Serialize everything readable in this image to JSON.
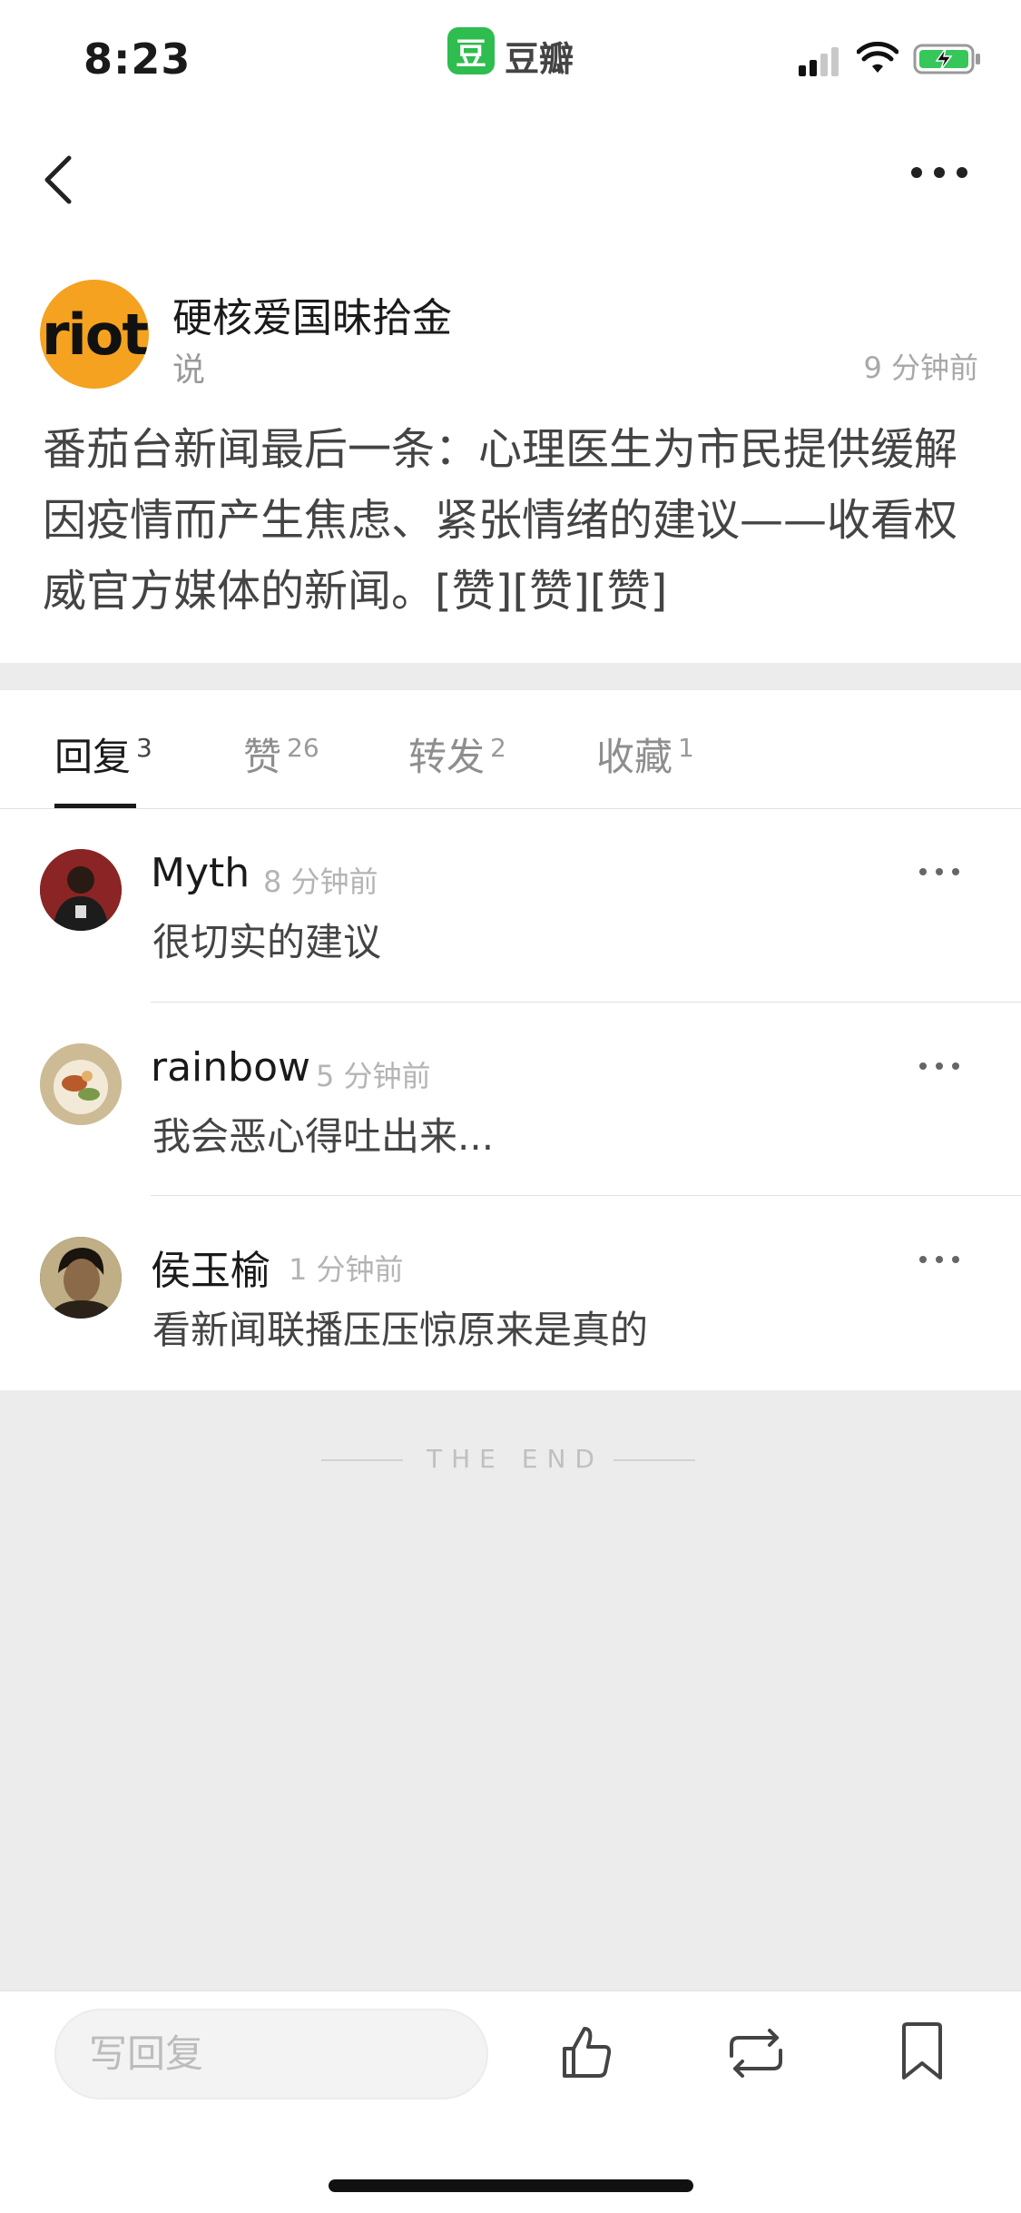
{
  "status_bar": {
    "time": "8:23",
    "app_logo_glyph": "豆",
    "app_name": "豆瓣",
    "icons": [
      "signal-icon",
      "wifi-icon",
      "battery-charging-icon"
    ],
    "accent_color": "#2ebd4e"
  },
  "nav": {
    "icons": [
      "back-icon",
      "more-icon"
    ]
  },
  "post": {
    "avatar_text": "riot",
    "author": "硬核爱国昧拾金",
    "action": "说",
    "time": "9 分钟前",
    "content": "番茄台新闻最后一条：心理医生为市民提供缓解因疫情而产生焦虑、紧张情绪的建议——收看权威官方媒体的新闻。[赞][赞][赞]"
  },
  "tabs": [
    {
      "label": "回复",
      "count": "3"
    },
    {
      "label": "赞",
      "count": "26"
    },
    {
      "label": "转发",
      "count": "2"
    },
    {
      "label": "收藏",
      "count": "1"
    }
  ],
  "comments": [
    {
      "name": "Myth",
      "time": "8 分钟前",
      "text": "很切实的建议"
    },
    {
      "name": "rainbow",
      "time": "5 分钟前",
      "text": "我会恶心得吐出来..."
    },
    {
      "name": "侯玉榆",
      "time": "1 分钟前",
      "text": "看新闻联播压压惊原来是真的"
    }
  ],
  "end_text": "THE END",
  "bottom_bar": {
    "reply_placeholder": "写回复",
    "icons": [
      "like-icon",
      "repost-icon",
      "bookmark-icon"
    ]
  }
}
